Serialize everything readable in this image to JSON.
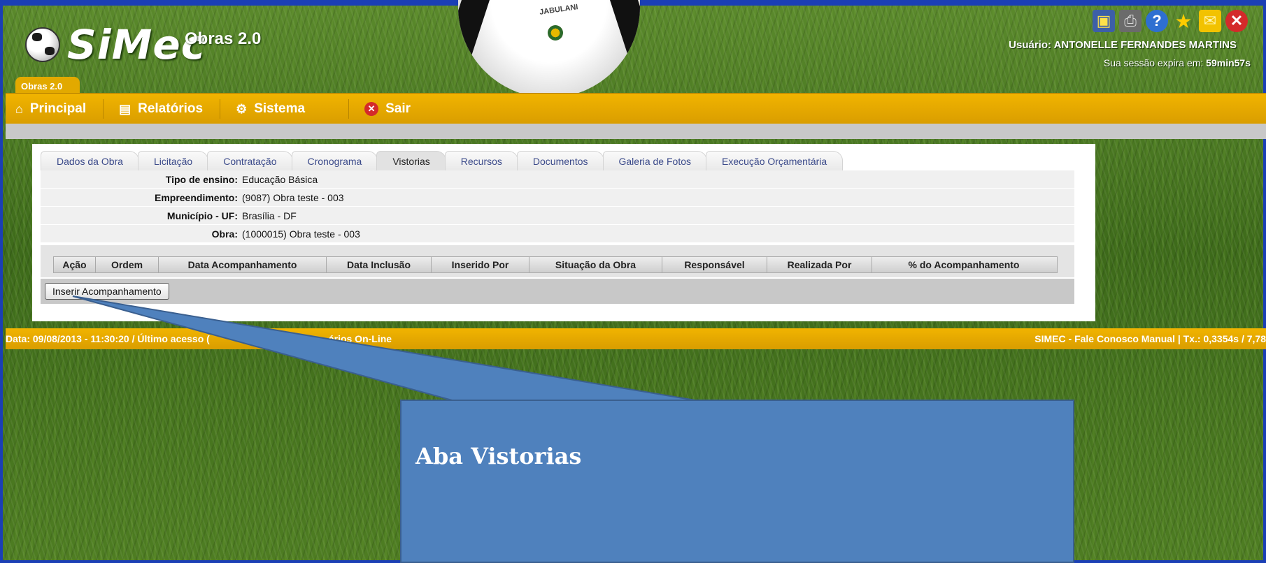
{
  "header": {
    "logo_text": "SiMec",
    "app_version": "Obras 2.0",
    "user_line": "Usuário: ANTONELLE FERNANDES MARTINS",
    "session_prefix": "Sua sessão expira em:",
    "session_time": "59min57s",
    "ball_brand": "JABULANI"
  },
  "module_tab": "Obras 2.0",
  "menu": {
    "principal": "Principal",
    "relatorios": "Relatórios",
    "sistema": "Sistema",
    "sair": "Sair"
  },
  "tabs": [
    {
      "label": "Dados da Obra"
    },
    {
      "label": "Licitação"
    },
    {
      "label": "Contratação"
    },
    {
      "label": "Cronograma"
    },
    {
      "label": "Vistorias",
      "active": true
    },
    {
      "label": "Recursos"
    },
    {
      "label": "Documentos"
    },
    {
      "label": "Galeria de Fotos"
    },
    {
      "label": "Execução Orçamentária"
    }
  ],
  "info": [
    {
      "label": "Tipo de ensino:",
      "value": "Educação Básica"
    },
    {
      "label": "Empreendimento:",
      "value": "(9087) Obra teste - 003"
    },
    {
      "label": "Município - UF:",
      "value": "Brasília - DF"
    },
    {
      "label": "Obra:",
      "value": "(1000015) Obra teste - 003"
    }
  ],
  "grid_headers": [
    "Ação",
    "Ordem",
    "Data Acompanhamento",
    "Data Inclusão",
    "Inserido Por",
    "Situação da Obra",
    "Responsável",
    "Realizada Por",
    "% do Acompanhamento"
  ],
  "insert_button": "Inserir Acompanhamento",
  "footer": {
    "left": "Data: 09/08/2013 - 11:30:20 / Último acesso (",
    "left_tail": "ários On-Line",
    "right": "SIMEC - Fale Conosco Manual    | Tx.: 0,3354s / 7,78"
  },
  "callout": {
    "title": "Aba Vistorias"
  },
  "colors": {
    "menu_bar": "#f1b400",
    "frame": "#1b3fb5",
    "callout": "#4f81bd"
  },
  "icons": [
    "monitor-icon",
    "printer-icon",
    "help-icon",
    "star-icon",
    "mail-icon",
    "close-icon",
    "home-icon",
    "reports-icon",
    "gear-icon",
    "exit-icon"
  ]
}
